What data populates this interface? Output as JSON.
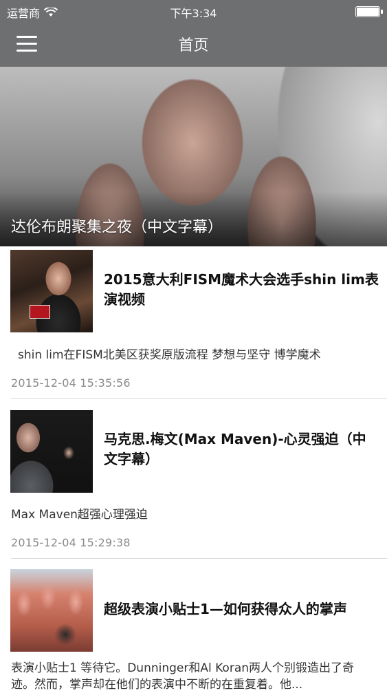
{
  "status_bar": {
    "carrier": "运营商",
    "time": "下午3:34"
  },
  "nav": {
    "title": "首页"
  },
  "hero": {
    "title": "达伦布朗聚集之夜（中文字幕）"
  },
  "feed": [
    {
      "title": "2015意大利FISM魔术大会选手shin lim表演视频",
      "description": "shin lim在FISM北美区获奖原版流程 梦想与坚守 博学魔术",
      "time": "2015-12-04 15:35:56"
    },
    {
      "title": "马克思.梅文(Max Maven)-心灵强迫（中文字幕）",
      "description": "Max Maven超强心理强迫",
      "time": "2015-12-04 15:29:38"
    },
    {
      "title": "超级表演小贴士1—如何获得众人的掌声",
      "description": "表演小贴士1 等待它。Dunninger和Al Koran两人个别锻造出了奇迹。然而，掌声却在他们的表演中不断的在重复着。他..."
    }
  ]
}
